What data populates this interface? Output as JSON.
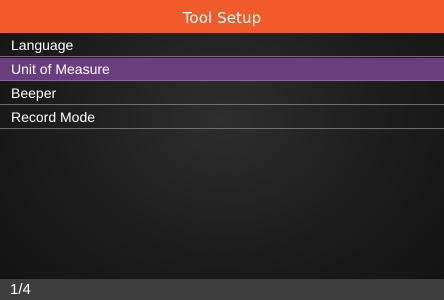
{
  "header": {
    "title": "Tool Setup"
  },
  "menu": {
    "items": [
      {
        "label": "Language",
        "selected": false
      },
      {
        "label": "Unit of Measure",
        "selected": true
      },
      {
        "label": "Beeper",
        "selected": false
      },
      {
        "label": "Record Mode",
        "selected": false
      }
    ]
  },
  "footer": {
    "page_indicator": "1/4"
  },
  "colors": {
    "title_bar": "#f15a29",
    "selected_item": "#6a3e7e",
    "status_bar": "#3d3d3d"
  }
}
